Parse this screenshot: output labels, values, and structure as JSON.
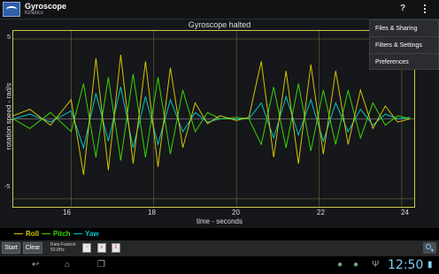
{
  "app": {
    "title": "Gyroscope",
    "subtitle": "Kinetics"
  },
  "actions": {
    "help": "?"
  },
  "graph": {
    "title": "Gyroscope halted",
    "ylabel": "rotation speed - rad/s",
    "xlabel": "time - seconds",
    "yticks": [
      "5",
      "-5"
    ],
    "xticks": [
      "16",
      "18",
      "20",
      "22",
      "24"
    ]
  },
  "menu": [
    "Files & Sharing",
    "Filters & Settings",
    "Preferences"
  ],
  "legend": [
    {
      "label": "Roll",
      "color": "#d4c300"
    },
    {
      "label": "Pitch",
      "color": "#39d400"
    },
    {
      "label": "Yaw",
      "color": "#00c8c8"
    }
  ],
  "toolbar": {
    "start": "Start",
    "clear": "Clear",
    "rate_line1": "Rate:Fastest",
    "rate_line2": "50.8Hz"
  },
  "status": {
    "time": "12:50"
  },
  "chart_data": {
    "type": "line",
    "title": "Gyroscope halted",
    "xlabel": "time - seconds",
    "ylabel": "rotation speed - rad/s",
    "xlim": [
      14.6,
      24.3
    ],
    "ylim": [
      -5.5,
      5.5
    ],
    "series": [
      {
        "name": "Roll",
        "x": [
          14.6,
          15.0,
          15.5,
          16.0,
          16.3,
          16.6,
          16.9,
          17.2,
          17.5,
          17.8,
          18.1,
          18.4,
          18.7,
          19.0,
          19.3,
          19.6,
          20.0,
          20.3,
          20.6,
          20.9,
          21.2,
          21.5,
          21.8,
          22.1,
          22.4,
          22.7,
          23.0,
          23.3,
          23.6,
          23.9,
          24.2
        ],
        "values": [
          0.2,
          0.6,
          -0.4,
          1.2,
          -3.5,
          3.8,
          -3.2,
          4.0,
          -2.8,
          3.6,
          -3.0,
          3.2,
          -1.8,
          1.0,
          -0.3,
          0.2,
          -0.1,
          0.1,
          3.6,
          -2.4,
          3.0,
          -2.8,
          3.4,
          -2.2,
          3.0,
          -1.6,
          1.8,
          -0.6,
          0.8,
          -0.2,
          0.0
        ]
      },
      {
        "name": "Pitch",
        "x": [
          14.6,
          15.0,
          15.5,
          16.0,
          16.3,
          16.6,
          16.9,
          17.2,
          17.5,
          17.8,
          18.1,
          18.4,
          18.7,
          19.0,
          19.3,
          19.6,
          20.0,
          20.3,
          20.6,
          20.9,
          21.2,
          21.5,
          21.8,
          22.1,
          22.4,
          22.7,
          23.0,
          23.3,
          23.6,
          23.9,
          24.2
        ],
        "values": [
          0.0,
          -0.6,
          0.4,
          -0.8,
          2.2,
          -2.4,
          2.6,
          -2.6,
          2.8,
          -2.4,
          2.6,
          -2.2,
          1.8,
          -0.8,
          0.4,
          0.0,
          0.1,
          0.0,
          -1.6,
          2.0,
          -1.8,
          2.2,
          -2.0,
          1.8,
          -1.6,
          1.8,
          -1.2,
          1.0,
          -0.4,
          0.2,
          0.0
        ]
      },
      {
        "name": "Yaw",
        "x": [
          14.6,
          15.0,
          15.5,
          16.0,
          16.3,
          16.6,
          16.9,
          17.2,
          17.5,
          17.8,
          18.1,
          18.4,
          18.7,
          19.0,
          19.3,
          19.6,
          20.0,
          20.3,
          20.6,
          20.9,
          21.2,
          21.5,
          21.8,
          22.1,
          22.4,
          22.7,
          23.0,
          23.3,
          23.6,
          23.9,
          24.2
        ],
        "values": [
          0.0,
          0.3,
          -0.2,
          0.5,
          -1.8,
          1.6,
          -1.4,
          2.0,
          -1.8,
          1.4,
          -1.6,
          1.2,
          -0.8,
          0.4,
          -0.2,
          0.0,
          0.0,
          0.0,
          1.0,
          -1.2,
          1.4,
          -1.0,
          1.2,
          -1.4,
          1.0,
          -0.8,
          0.6,
          -0.4,
          0.3,
          0.0,
          0.1
        ]
      }
    ],
    "grid": true
  }
}
